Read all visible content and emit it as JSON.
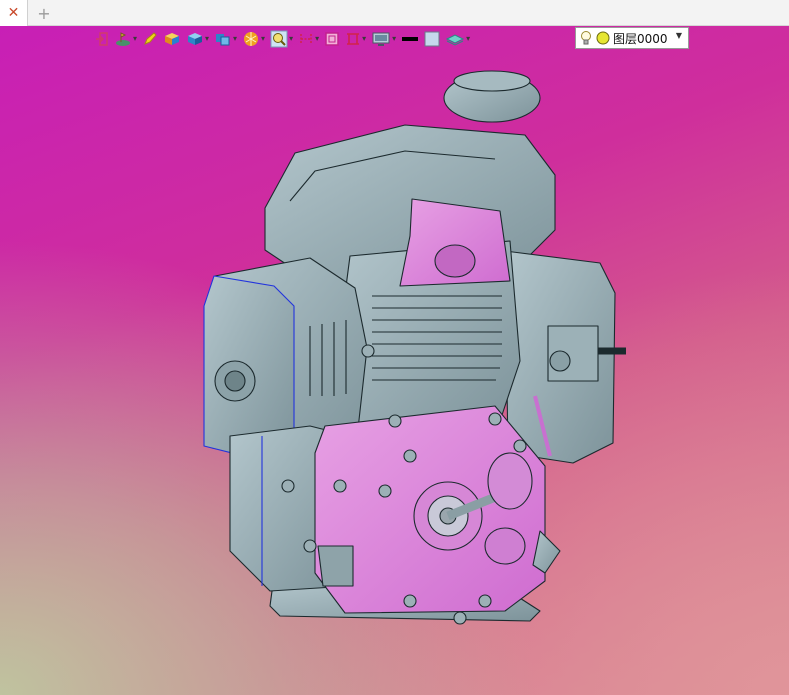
{
  "tabs": {
    "close_icon": "✕",
    "add_icon": "+"
  },
  "toolbar": {
    "buttons": [
      {
        "name": "import-icon",
        "dropdown": false
      },
      {
        "name": "sketch-icon",
        "dropdown": true
      },
      {
        "name": "pencil-icon",
        "dropdown": false
      },
      {
        "name": "box-icon",
        "dropdown": false
      },
      {
        "name": "solid-cube-icon",
        "dropdown": true
      },
      {
        "name": "assembly-icon",
        "dropdown": true
      },
      {
        "name": "render-sphere-icon",
        "dropdown": true
      },
      {
        "name": "zoom-icon",
        "dropdown": true
      },
      {
        "name": "dimension-icon",
        "dropdown": true
      },
      {
        "name": "frame-icon",
        "dropdown": false
      },
      {
        "name": "section-icon",
        "dropdown": true
      },
      {
        "name": "display-icon",
        "dropdown": true
      },
      {
        "name": "line-color-icon",
        "dropdown": false
      },
      {
        "name": "fill-color-icon",
        "dropdown": false
      },
      {
        "name": "layer-plane-icon",
        "dropdown": true
      }
    ],
    "layer": {
      "value": "图层0000",
      "bulb_icon": "lightbulb-icon",
      "status_icon": "yellow-circle-icon",
      "arrow_icon": "▼"
    }
  },
  "colors": {
    "body_metal": "#8fa5ab",
    "highlight_pink": "#dd86db",
    "edge": "#1c2a2e",
    "selection_edge": "#2233dd"
  }
}
